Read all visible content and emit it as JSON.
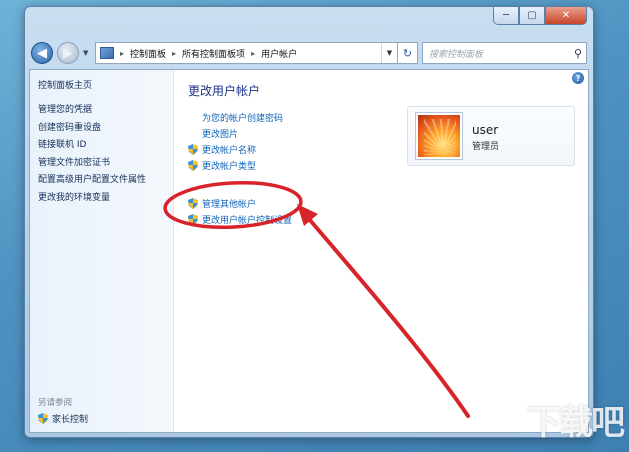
{
  "window": {
    "caption_buttons": {
      "minimize": "─",
      "maximize": "▢",
      "close": "✕"
    }
  },
  "address_bar": {
    "back_icon": "◀",
    "forward_icon": "▶",
    "path": [
      "控制面板",
      "所有控制面板项",
      "用户帐户"
    ],
    "separator": "▸",
    "refresh_icon": "↻",
    "search_placeholder": "搜索控制面板",
    "search_icon": "⚲"
  },
  "left_pane": {
    "home": "控制面板主页",
    "items": [
      "管理您的凭据",
      "创建密码重设盘",
      "链接联机 ID",
      "管理文件加密证书",
      "配置高级用户配置文件属性",
      "更改我的环境变量"
    ],
    "see_also": "另请参阅",
    "parental_controls": "家长控制"
  },
  "main": {
    "title": "更改用户帐户",
    "help_icon": "?",
    "links": {
      "create_password": "为您的帐户创建密码",
      "change_picture": "更改图片",
      "change_name": "更改帐户名称",
      "change_type": "更改帐户类型",
      "manage_other": "管理其他帐户",
      "uac_settings": "更改用户帐户控制设置"
    },
    "user_card": {
      "name": "user",
      "role": "管理员"
    }
  },
  "annotation": {
    "color": "#d8232a"
  },
  "watermark": "下载吧"
}
